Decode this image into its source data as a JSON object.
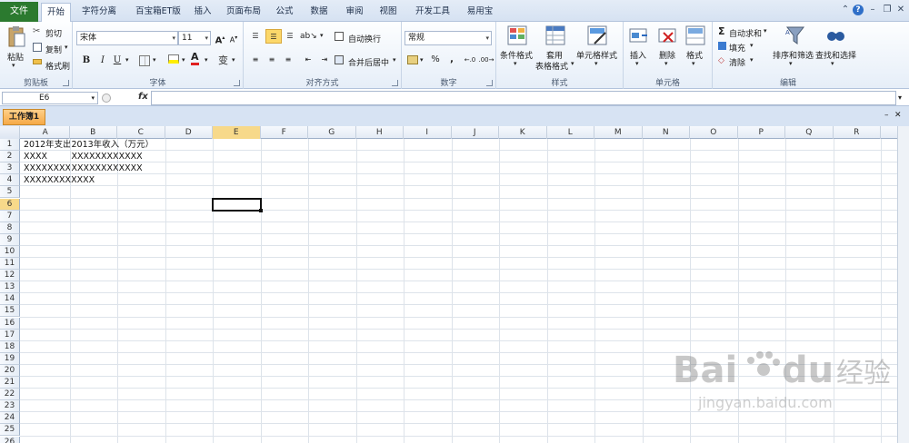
{
  "tabs": {
    "file": "文件",
    "items": [
      "开始",
      "字符分离",
      "百宝箱ET版",
      "插入",
      "页面布局",
      "公式",
      "数据",
      "审阅",
      "视图",
      "开发工具",
      "易用宝"
    ]
  },
  "ribbon": {
    "clipboard": {
      "paste": "粘贴",
      "cut": "剪切",
      "copy": "复制",
      "format_painter": "格式刷",
      "label": "剪贴板"
    },
    "font": {
      "name": "宋体",
      "size": "11",
      "bold": "B",
      "italic": "I",
      "underline": "U",
      "label": "字体",
      "grow": "A",
      "shrink": "A"
    },
    "alignment": {
      "wrap": "自动换行",
      "merge": "合并后居中",
      "label": "对齐方式"
    },
    "number": {
      "format": "常规",
      "percent": "%",
      "comma": ",",
      "label": "数字"
    },
    "styles": {
      "conditional": "条件格式",
      "table_line1": "套用",
      "table_line2": "表格格式",
      "cell_styles": "单元格样式",
      "label": "样式"
    },
    "cells": {
      "insert": "插入",
      "delete": "删除",
      "format": "格式",
      "label": "单元格"
    },
    "editing": {
      "autosum": "自动求和",
      "fill": "填充",
      "clear": "清除",
      "sort": "排序和筛选",
      "find": "查找和选择",
      "label": "编辑"
    }
  },
  "formula_bar": {
    "name_box": "E6",
    "fx": "fx",
    "value": ""
  },
  "workbook_tab": "工作簿1",
  "sheet": {
    "columns": [
      "A",
      "B",
      "C",
      "D",
      "E",
      "F",
      "G",
      "H",
      "I",
      "J",
      "K",
      "L",
      "M",
      "N",
      "O",
      "P",
      "Q",
      "R"
    ],
    "rows": [
      "1",
      "2",
      "3",
      "4",
      "5",
      "6",
      "7",
      "8",
      "9",
      "10",
      "11",
      "12",
      "13",
      "14",
      "15",
      "16",
      "17",
      "18",
      "19",
      "20",
      "21",
      "22",
      "23",
      "24",
      "25",
      "26"
    ],
    "selected_col": "E",
    "selected_row": "6",
    "cells": {
      "A1": "2012年支出",
      "B1": "2013年收入（万元）",
      "A2": "XXXX",
      "B2": "XXXXXXXXXXXX",
      "A3": "XXXXXXXXXXXX",
      "B3": "XXXXXXXXXXXX",
      "A4": "XXXXXXXXXXXX"
    }
  },
  "watermark": {
    "brand": "Bai",
    "brand2": "du",
    "cn": "经验",
    "url": "jingyan.baidu.com"
  }
}
